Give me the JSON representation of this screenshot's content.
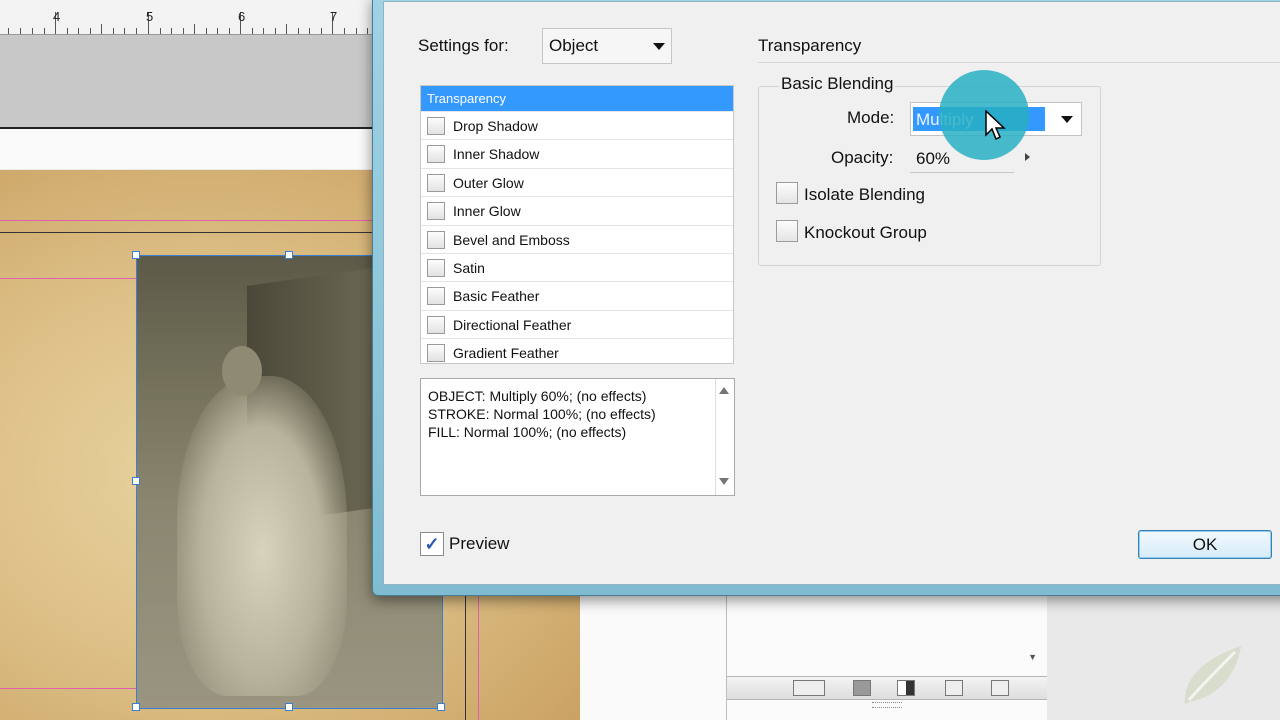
{
  "background": {
    "ruler_numbers": [
      "4",
      "5",
      "6",
      "7"
    ]
  },
  "dialog": {
    "settings_for_label": "Settings for:",
    "settings_for_value": "Object",
    "effects": {
      "selected": "Transparency",
      "items": [
        "Drop Shadow",
        "Inner Shadow",
        "Outer Glow",
        "Inner Glow",
        "Bevel and Emboss",
        "Satin",
        "Basic Feather",
        "Directional Feather",
        "Gradient Feather"
      ]
    },
    "summary_lines": [
      "OBJECT: Multiply 60%; (no effects)",
      "STROKE: Normal 100%; (no effects)",
      "FILL: Normal 100%; (no effects)"
    ],
    "preview_label": "Preview",
    "preview_checked": true,
    "section_title": "Transparency",
    "basic_blending": {
      "title": "Basic Blending",
      "mode_label": "Mode:",
      "mode_value": "Multiply",
      "opacity_label": "Opacity:",
      "opacity_value": "60%",
      "isolate_label": "Isolate Blending",
      "knockout_label": "Knockout Group"
    },
    "ok_label": "OK"
  },
  "colors": {
    "selection": "#3399ff",
    "dialog_frame": "#8fc8dc",
    "highlight_circle": "#28afc3"
  },
  "icons": [
    "chevron-down-icon",
    "checkmark-icon",
    "pointer-cursor-icon",
    "leaf-logo-icon"
  ]
}
